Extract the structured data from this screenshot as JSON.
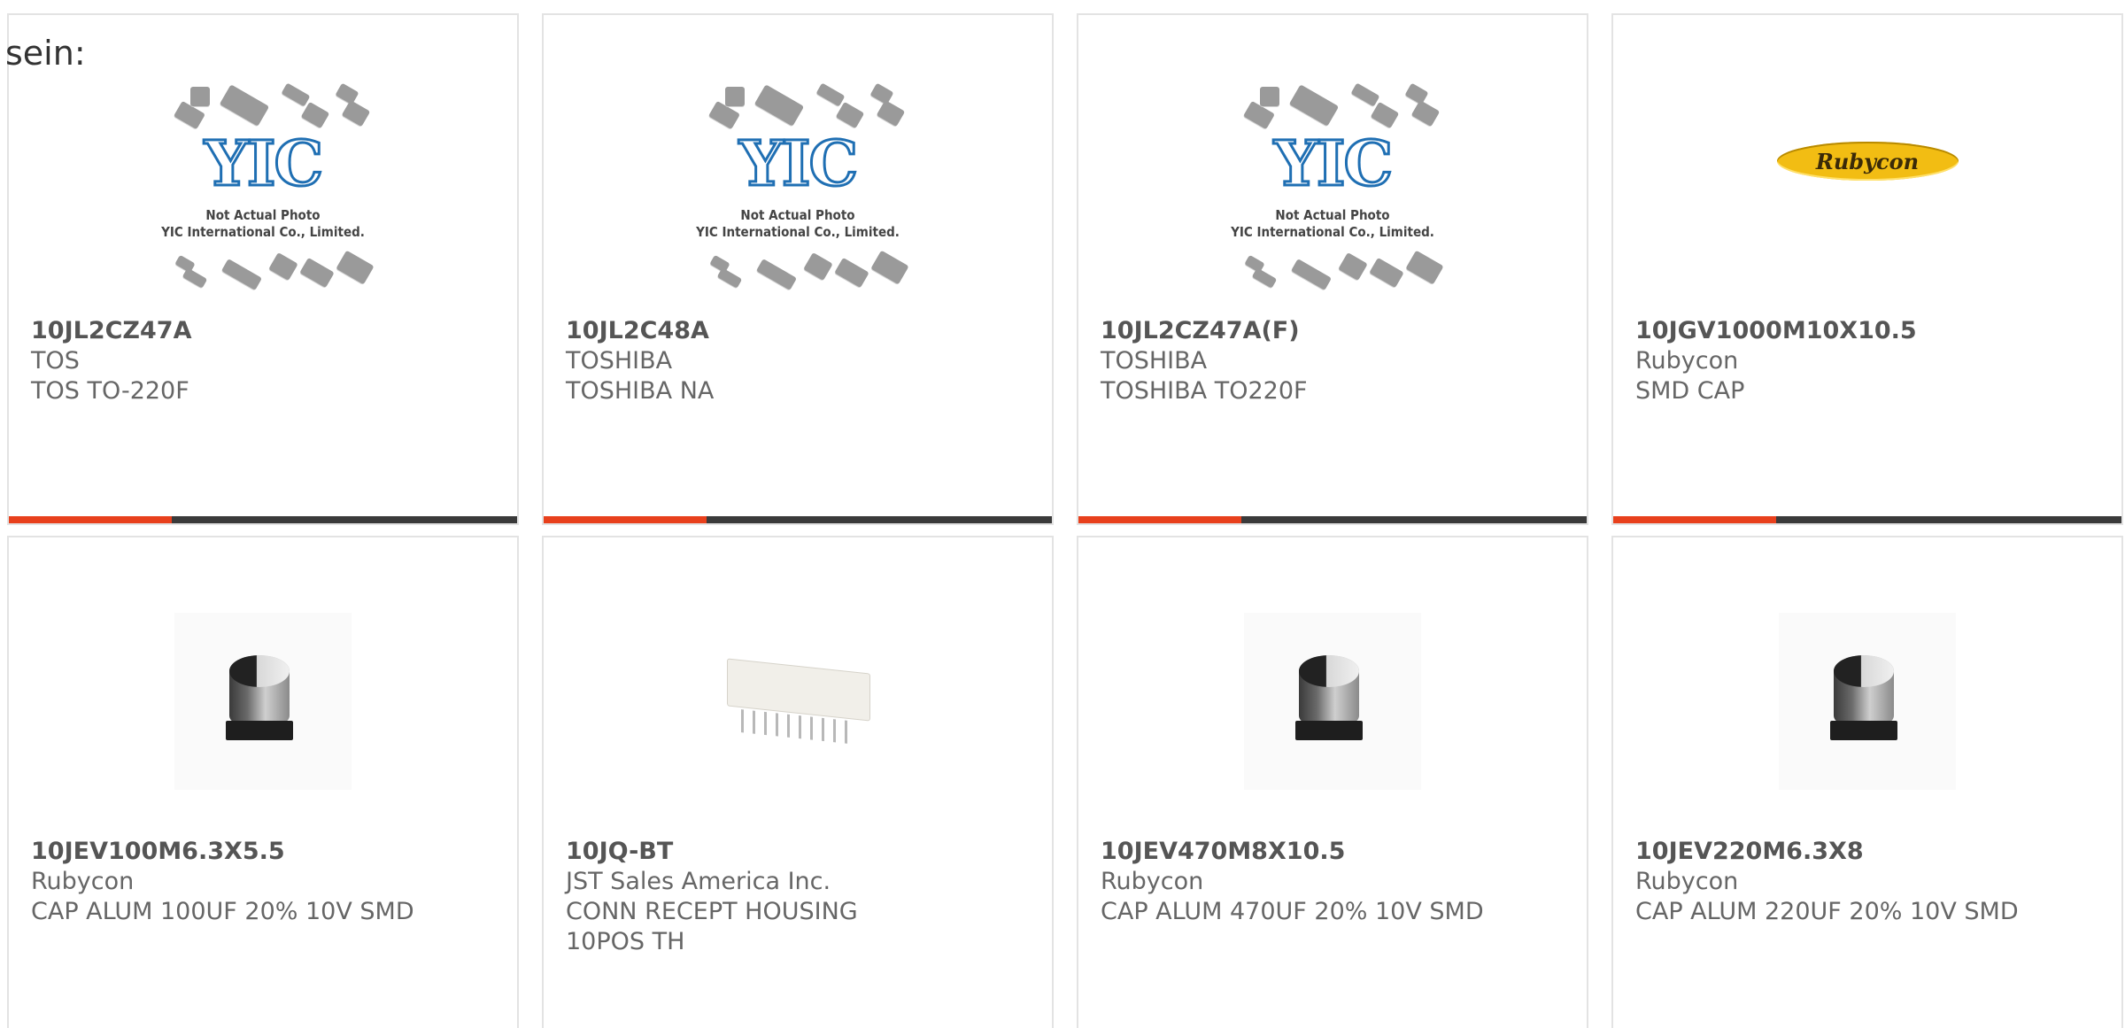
{
  "intro": {
    "text": "sein:"
  },
  "products": [
    {
      "part_number": "10JL2CZ47A",
      "manufacturer": "TOS",
      "description": "TOS TO-220F",
      "image": "yic-placeholder",
      "image_caption_line1": "Not Actual Photo",
      "image_caption_line2": "YIC International Co., Limited.",
      "image_logo": "YIC"
    },
    {
      "part_number": "10JL2C48A",
      "manufacturer": "TOSHIBA",
      "description": "TOSHIBA NA",
      "image": "yic-placeholder",
      "image_caption_line1": "Not Actual Photo",
      "image_caption_line2": "YIC International Co., Limited.",
      "image_logo": "YIC"
    },
    {
      "part_number": "10JL2CZ47A(F)",
      "manufacturer": "TOSHIBA",
      "description": "TOSHIBA TO220F",
      "image": "yic-placeholder",
      "image_caption_line1": "Not Actual Photo",
      "image_caption_line2": "YIC International Co., Limited.",
      "image_logo": "YIC"
    },
    {
      "part_number": "10JGV1000M10X10.5",
      "manufacturer": "Rubycon",
      "description": "SMD CAP",
      "image": "rubycon-logo",
      "image_logo": "Rubycon"
    },
    {
      "part_number": "10JEV100M6.3X5.5",
      "manufacturer": "Rubycon",
      "description": "CAP ALUM 100UF 20% 10V SMD",
      "image": "smd-capacitor-photo"
    },
    {
      "part_number": "10JQ-BT",
      "manufacturer": "JST Sales America Inc.",
      "description": "CONN RECEPT HOUSING 10POS TH",
      "image": "connector-housing-photo"
    },
    {
      "part_number": "10JEV470M8X10.5",
      "manufacturer": "Rubycon",
      "description": "CAP ALUM 470UF 20% 10V SMD",
      "image": "smd-capacitor-photo"
    },
    {
      "part_number": "10JEV220M6.3X8",
      "manufacturer": "Rubycon",
      "description": "CAP ALUM 220UF 20% 10V SMD",
      "image": "smd-capacitor-photo"
    }
  ],
  "colors": {
    "accent": "#e8401c",
    "bar": "#3a3a3a",
    "border": "#e3e3e3",
    "text": "#666666",
    "yic_blue": "#1f6fb3",
    "rubycon_yellow": "#f2bd13"
  }
}
